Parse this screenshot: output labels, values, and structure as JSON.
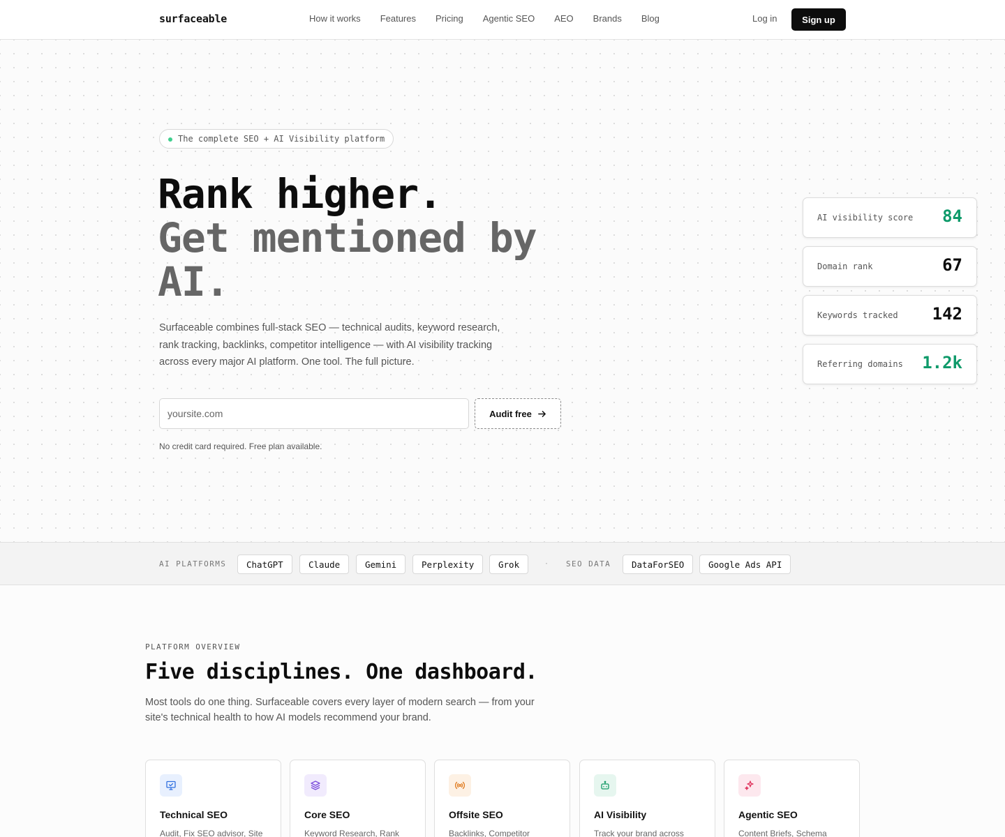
{
  "nav": {
    "logo": "surfaceable",
    "links": [
      "How it works",
      "Features",
      "Pricing",
      "Agentic SEO",
      "AEO",
      "Brands",
      "Blog"
    ],
    "login": "Log in",
    "signup": "Sign up"
  },
  "hero": {
    "badge": "The complete SEO + AI Visibility platform",
    "title_line1": "Rank higher.",
    "title_line2": "Get mentioned by AI.",
    "description": "Surfaceable combines full-stack SEO — technical audits, keyword research, rank tracking, backlinks, competitor intelligence — with AI visibility tracking across every major AI platform. One tool. The full picture.",
    "input_placeholder": "yoursite.com",
    "audit_button": "Audit free",
    "note": "No credit card required. Free plan available."
  },
  "stats": [
    {
      "label": "AI visibility score",
      "value": "84",
      "color": "#0e9a6a"
    },
    {
      "label": "Domain rank",
      "value": "67",
      "color": "#0d0d0d"
    },
    {
      "label": "Keywords tracked",
      "value": "142",
      "color": "#0d0d0d"
    },
    {
      "label": "Referring domains",
      "value": "1.2k",
      "color": "#0e9a6a"
    }
  ],
  "strip": {
    "ai_label": "AI PLATFORMS",
    "ai_platforms": [
      "ChatGPT",
      "Claude",
      "Gemini",
      "Perplexity",
      "Grok"
    ],
    "separator": "·",
    "seo_label": "SEO DATA",
    "seo_sources": [
      "DataForSEO",
      "Google Ads API"
    ]
  },
  "overview": {
    "eyebrow": "PLATFORM OVERVIEW",
    "title": "Five disciplines. One dashboard.",
    "description": "Most tools do one thing. Surfaceable covers every layer of modern search — from your site's technical health to how AI models recommend your brand."
  },
  "features": [
    {
      "title": "Technical SEO",
      "subtitle": "Audit, Fix SEO advisor, Site",
      "icon": "monitor-icon",
      "bg": "#e8f0fe",
      "fg": "#2f6fe0"
    },
    {
      "title": "Core SEO",
      "subtitle": "Keyword Research, Rank",
      "icon": "layers-icon",
      "bg": "#f1ebfd",
      "fg": "#7c4ddc"
    },
    {
      "title": "Offsite SEO",
      "subtitle": "Backlinks, Competitor",
      "icon": "broadcast-icon",
      "bg": "#fdf1e4",
      "fg": "#e07b1f"
    },
    {
      "title": "AI Visibility",
      "subtitle": "Track your brand across",
      "icon": "robot-icon",
      "bg": "#e6f6ef",
      "fg": "#159a66"
    },
    {
      "title": "Agentic SEO",
      "subtitle": "Content Briefs, Schema",
      "icon": "sparkles-icon",
      "bg": "#fde8ee",
      "fg": "#e0365f"
    }
  ]
}
